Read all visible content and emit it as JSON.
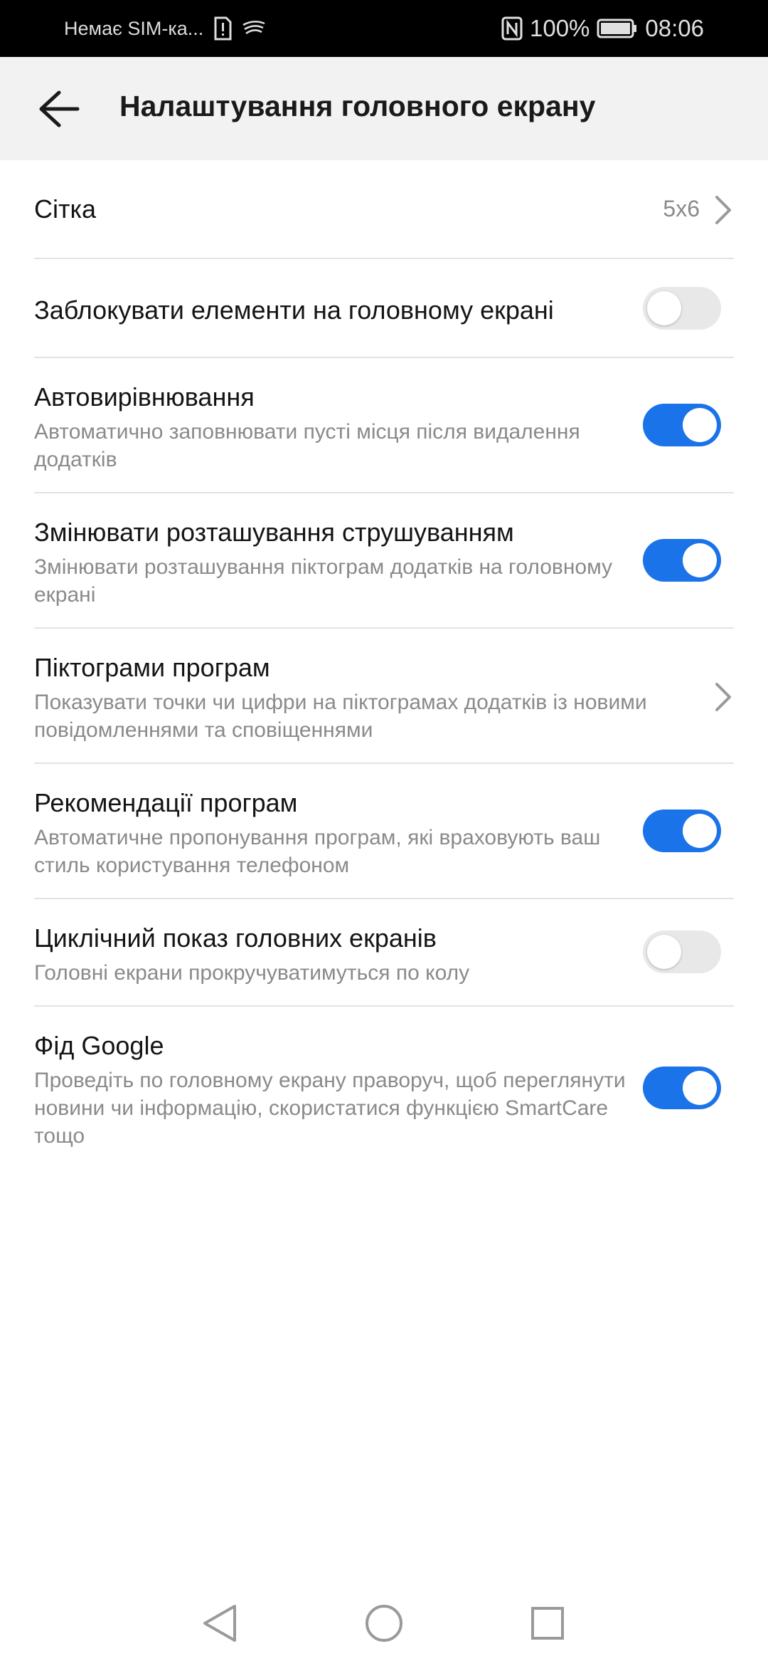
{
  "status_bar": {
    "carrier": "Немає SIM-ка...",
    "battery_percent": "100%",
    "time": "08:06",
    "icons": [
      "sim-alert-icon",
      "signal-swirl-icon",
      "nfc-icon",
      "battery-icon"
    ]
  },
  "header": {
    "title": "Налаштування головного екрану",
    "back_icon": "arrow-left-icon"
  },
  "settings": {
    "grid": {
      "title": "Сітка",
      "value": "5x6"
    },
    "lock_items": {
      "title": "Заблокувати елементи на головному екрані",
      "enabled": false
    },
    "auto_align": {
      "title": "Автовирівнювання",
      "subtitle": "Автоматично заповнювати пусті місця після видалення додатків",
      "enabled": true
    },
    "shake": {
      "title": "Змінювати розташування струшуванням",
      "subtitle": "Змінювати розташування піктограм додатків на головному екрані",
      "enabled": true
    },
    "badges": {
      "title": "Піктограми програм",
      "subtitle": "Показувати точки чи цифри на піктограмах додатків із новими повідомленнями та сповіщеннями"
    },
    "recommendations": {
      "title": "Рекомендації програм",
      "subtitle": "Автоматичне пропонування програм, які враховують ваш стиль користування телефоном",
      "enabled": true
    },
    "cyclic": {
      "title": "Циклічний показ головних екранів",
      "subtitle": "Головні екрани прокручуватимуться по колу",
      "enabled": false
    },
    "google_feed": {
      "title": "Фід Google",
      "subtitle": "Проведіть по головному екрану праворуч, щоб переглянути новини чи інформацію, скористатися функцією SmartCare тощо",
      "enabled": true
    }
  },
  "colors": {
    "accent": "#1a73e8",
    "toggle_off": "#e8e8e8",
    "divider": "#e3e3e3",
    "header_bg": "#f2f2f2"
  },
  "nav_bar": {
    "icons": [
      "back-triangle-icon",
      "home-circle-icon",
      "recents-square-icon"
    ]
  }
}
